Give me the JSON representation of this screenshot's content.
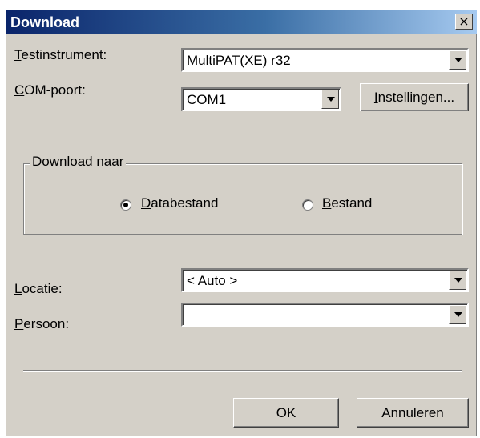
{
  "window": {
    "title": "Download",
    "close_label": "×"
  },
  "testinstrument": {
    "label_key": "T",
    "label_rest": "estinstrument:",
    "value": "MultiPAT(XE) r32"
  },
  "comport": {
    "label_key": "C",
    "label_rest": "OM-poort:",
    "value": "COM1",
    "settings_key": "I",
    "settings_rest": "nstellingen..."
  },
  "download_target": {
    "group_title": "Download naar",
    "options": [
      {
        "key": "D",
        "rest": "atabestand",
        "checked": true
      },
      {
        "key": "B",
        "rest": "estand",
        "checked": false
      }
    ]
  },
  "locatie": {
    "label_key": "L",
    "label_rest": "ocatie:",
    "value": "< Auto >"
  },
  "persoon": {
    "label_key": "P",
    "label_rest": "ersoon:",
    "value": ""
  },
  "buttons": {
    "ok": "OK",
    "cancel": "Annuleren"
  }
}
